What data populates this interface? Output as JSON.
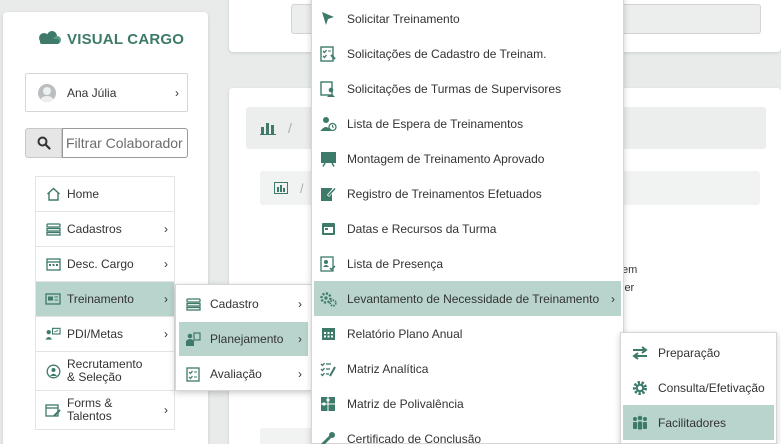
{
  "brand": {
    "name": "VISUAL CARGO",
    "color": "#3d7a6a"
  },
  "user": {
    "name": "Ana Júlia"
  },
  "search": {
    "placeholder": "Filtrar Colaborador"
  },
  "sidebar": {
    "items": [
      {
        "label": "Home",
        "icon": "home-icon"
      },
      {
        "label": "Cadastros",
        "icon": "list-icon"
      },
      {
        "label": "Desc. Cargo",
        "icon": "calendar-icon"
      },
      {
        "label": "Treinamento",
        "icon": "training-icon",
        "active": true
      },
      {
        "label": "PDI/Metas",
        "icon": "people-chart-icon"
      },
      {
        "label": "Recrutamento & Seleção",
        "icon": "user-search-icon"
      },
      {
        "label": "Forms & Talentos",
        "icon": "form-edit-icon"
      }
    ]
  },
  "submenu_treinamento": {
    "items": [
      {
        "label": "Cadastro",
        "icon": "list-icon"
      },
      {
        "label": "Planejamento",
        "icon": "planning-icon",
        "active": true
      },
      {
        "label": "Avaliação",
        "icon": "checklist-icon"
      }
    ]
  },
  "submenu_planejamento": {
    "items": [
      {
        "label": "Solicitar Treinamento",
        "icon": "pointer-icon"
      },
      {
        "label": "Solicitações de Cadastro de Treinam.",
        "icon": "list-check-icon"
      },
      {
        "label": "Solicitações de Turmas de Supervisores",
        "icon": "supervisor-icon"
      },
      {
        "label": "Lista de Espera de Treinamentos",
        "icon": "user-clock-icon"
      },
      {
        "label": "Montagem de Treinamento Aprovado",
        "icon": "presentation-icon"
      },
      {
        "label": "Registro de Treinamentos Efetuados",
        "icon": "edit-doc-icon"
      },
      {
        "label": "Datas e Recursos da Turma",
        "icon": "calendar-icon"
      },
      {
        "label": "Lista de Presença",
        "icon": "attendance-icon"
      },
      {
        "label": "Levantamento de Necessidade de Treinamento",
        "icon": "gears-icon",
        "active": true
      },
      {
        "label": "Relatório Plano Anual",
        "icon": "calendar-grid-icon"
      },
      {
        "label": "Matriz Analítica",
        "icon": "matrix-list-icon"
      },
      {
        "label": "Matriz de Polivalência",
        "icon": "puzzle-icon"
      },
      {
        "label": "Certificado de Conclusão",
        "icon": "certificate-icon"
      }
    ]
  },
  "submenu_levantamento": {
    "items": [
      {
        "label": "Preparação",
        "icon": "exchange-icon"
      },
      {
        "label": "Consulta/Efetivação",
        "icon": "gear-icon"
      },
      {
        "label": "Facilitadores",
        "icon": "group-icon",
        "active": true
      }
    ]
  },
  "background_fragments": {
    "line1": "em",
    "line2": "ier"
  },
  "colors": {
    "accent": "#3d7a6a",
    "active_bg": "#b8d4cc",
    "icon": "#3d7a6a"
  }
}
